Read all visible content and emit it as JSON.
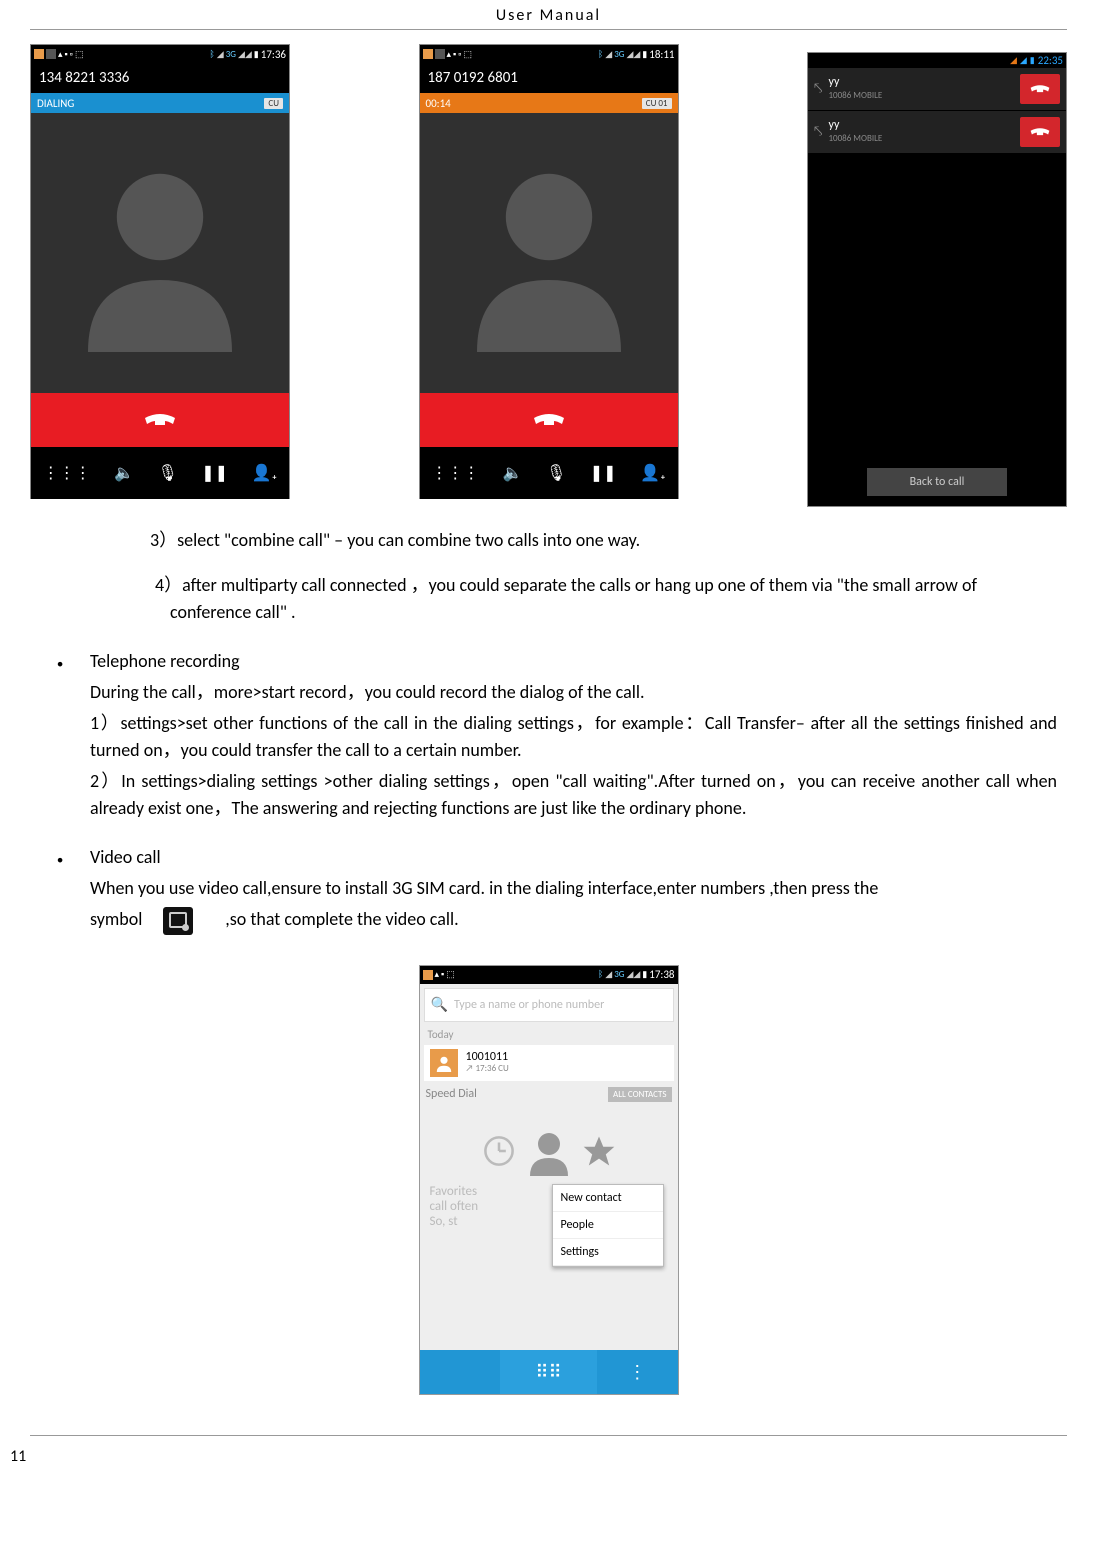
{
  "header": "User    Manual",
  "page_number": "11",
  "shot1": {
    "number": "134 8221 3336",
    "status": "DIALING",
    "badge": "CU",
    "time": "17:36"
  },
  "shot2": {
    "number": "187 0192 6801",
    "status": "00:14",
    "badge": "CU 01",
    "time": "18:11"
  },
  "shot3": {
    "time": "22:35",
    "calls": [
      {
        "name": "yy",
        "sub": "10086   MOBILE"
      },
      {
        "name": "yy",
        "sub": "10086   MOBILE"
      }
    ],
    "back": "Back to call"
  },
  "steps": {
    "s3": "3）select \"combine call\" – you can combine two calls into one way.",
    "s4": "4）after multiparty call connected ，you could separate the calls or hang up one of them via \"the small arrow of conference call\" ."
  },
  "recording": {
    "title": "Telephone recording",
    "line1": "During the call，more>start record，you could record the dialog of the call.",
    "line2": "   1）settings>set other functions of the call in the dialing settings，for example：Call Transfer– after all the settings finished and turned on，you could transfer the call to a certain number.",
    "line3": "   2）In settings>dialing settings >other dialing settings，open  \"call waiting\".After turned on，you can receive another call when already exist one，The answering and rejecting functions are just like the ordinary phone."
  },
  "video": {
    "title": "Video call",
    "line_a": "When you use video call,ensure to install 3G SIM card. in the dialing interface,enter numbers ,then press the",
    "line_b_pre": "symbol",
    "line_b_post": ",so that complete the video call."
  },
  "dialer": {
    "time": "17:38",
    "placeholder": "Type a name or phone number",
    "today": "Today",
    "contact_name": "1001011",
    "contact_sub": "↗ 17:36  CU",
    "speed": "Speed Dial",
    "all": "ALL CONTACTS",
    "fav1": "Favorites ",
    "fav2": "call often ",
    "fav3": "So, st",
    "menu": [
      "New contact",
      "People",
      "Settings"
    ]
  }
}
